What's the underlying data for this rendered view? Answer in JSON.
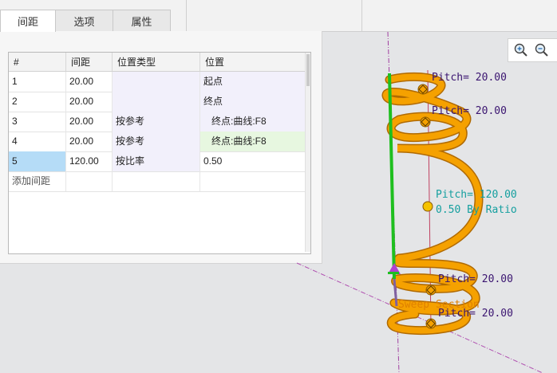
{
  "tabs": [
    {
      "label": "间距"
    },
    {
      "label": "选项"
    },
    {
      "label": "属性"
    }
  ],
  "table": {
    "headers": [
      "#",
      "间距",
      "位置类型",
      "位置"
    ],
    "rows": [
      {
        "num": "1",
        "pitch": "20.00",
        "type": "",
        "position": "起点"
      },
      {
        "num": "2",
        "pitch": "20.00",
        "type": "",
        "position": "终点"
      },
      {
        "num": "3",
        "pitch": "20.00",
        "type": "按参考",
        "position": "终点:曲线:F8"
      },
      {
        "num": "4",
        "pitch": "20.00",
        "type": "按参考",
        "position": "终点:曲线:F8"
      },
      {
        "num": "5",
        "pitch": "120.00",
        "type": "按比率",
        "position": "0.50"
      }
    ],
    "add_row_label": "添加间距"
  },
  "viewport": {
    "labels": {
      "pitch_top1": "Pitch= 20.00",
      "pitch_top2": "Pitch= 20.00",
      "pitch_mid": "Pitch= 120.00",
      "ratio_mid": "0.50 By Ratio",
      "pitch_bot1": "Pitch= 20.00",
      "pitch_bot2": "Pitch= 20.00",
      "sweep_section": "Sweep Section"
    },
    "colors": {
      "spring": "#f5a100",
      "spring_edge": "#b06a00",
      "trajectory": "#1fbf1f",
      "pitch_label": "#3a1470",
      "ratio_label": "#149f9f",
      "sweep_label": "#e08000",
      "axis_line": "#a040a0"
    },
    "toolbar_icons": [
      "zoom-in-icon",
      "zoom-out-icon"
    ]
  }
}
